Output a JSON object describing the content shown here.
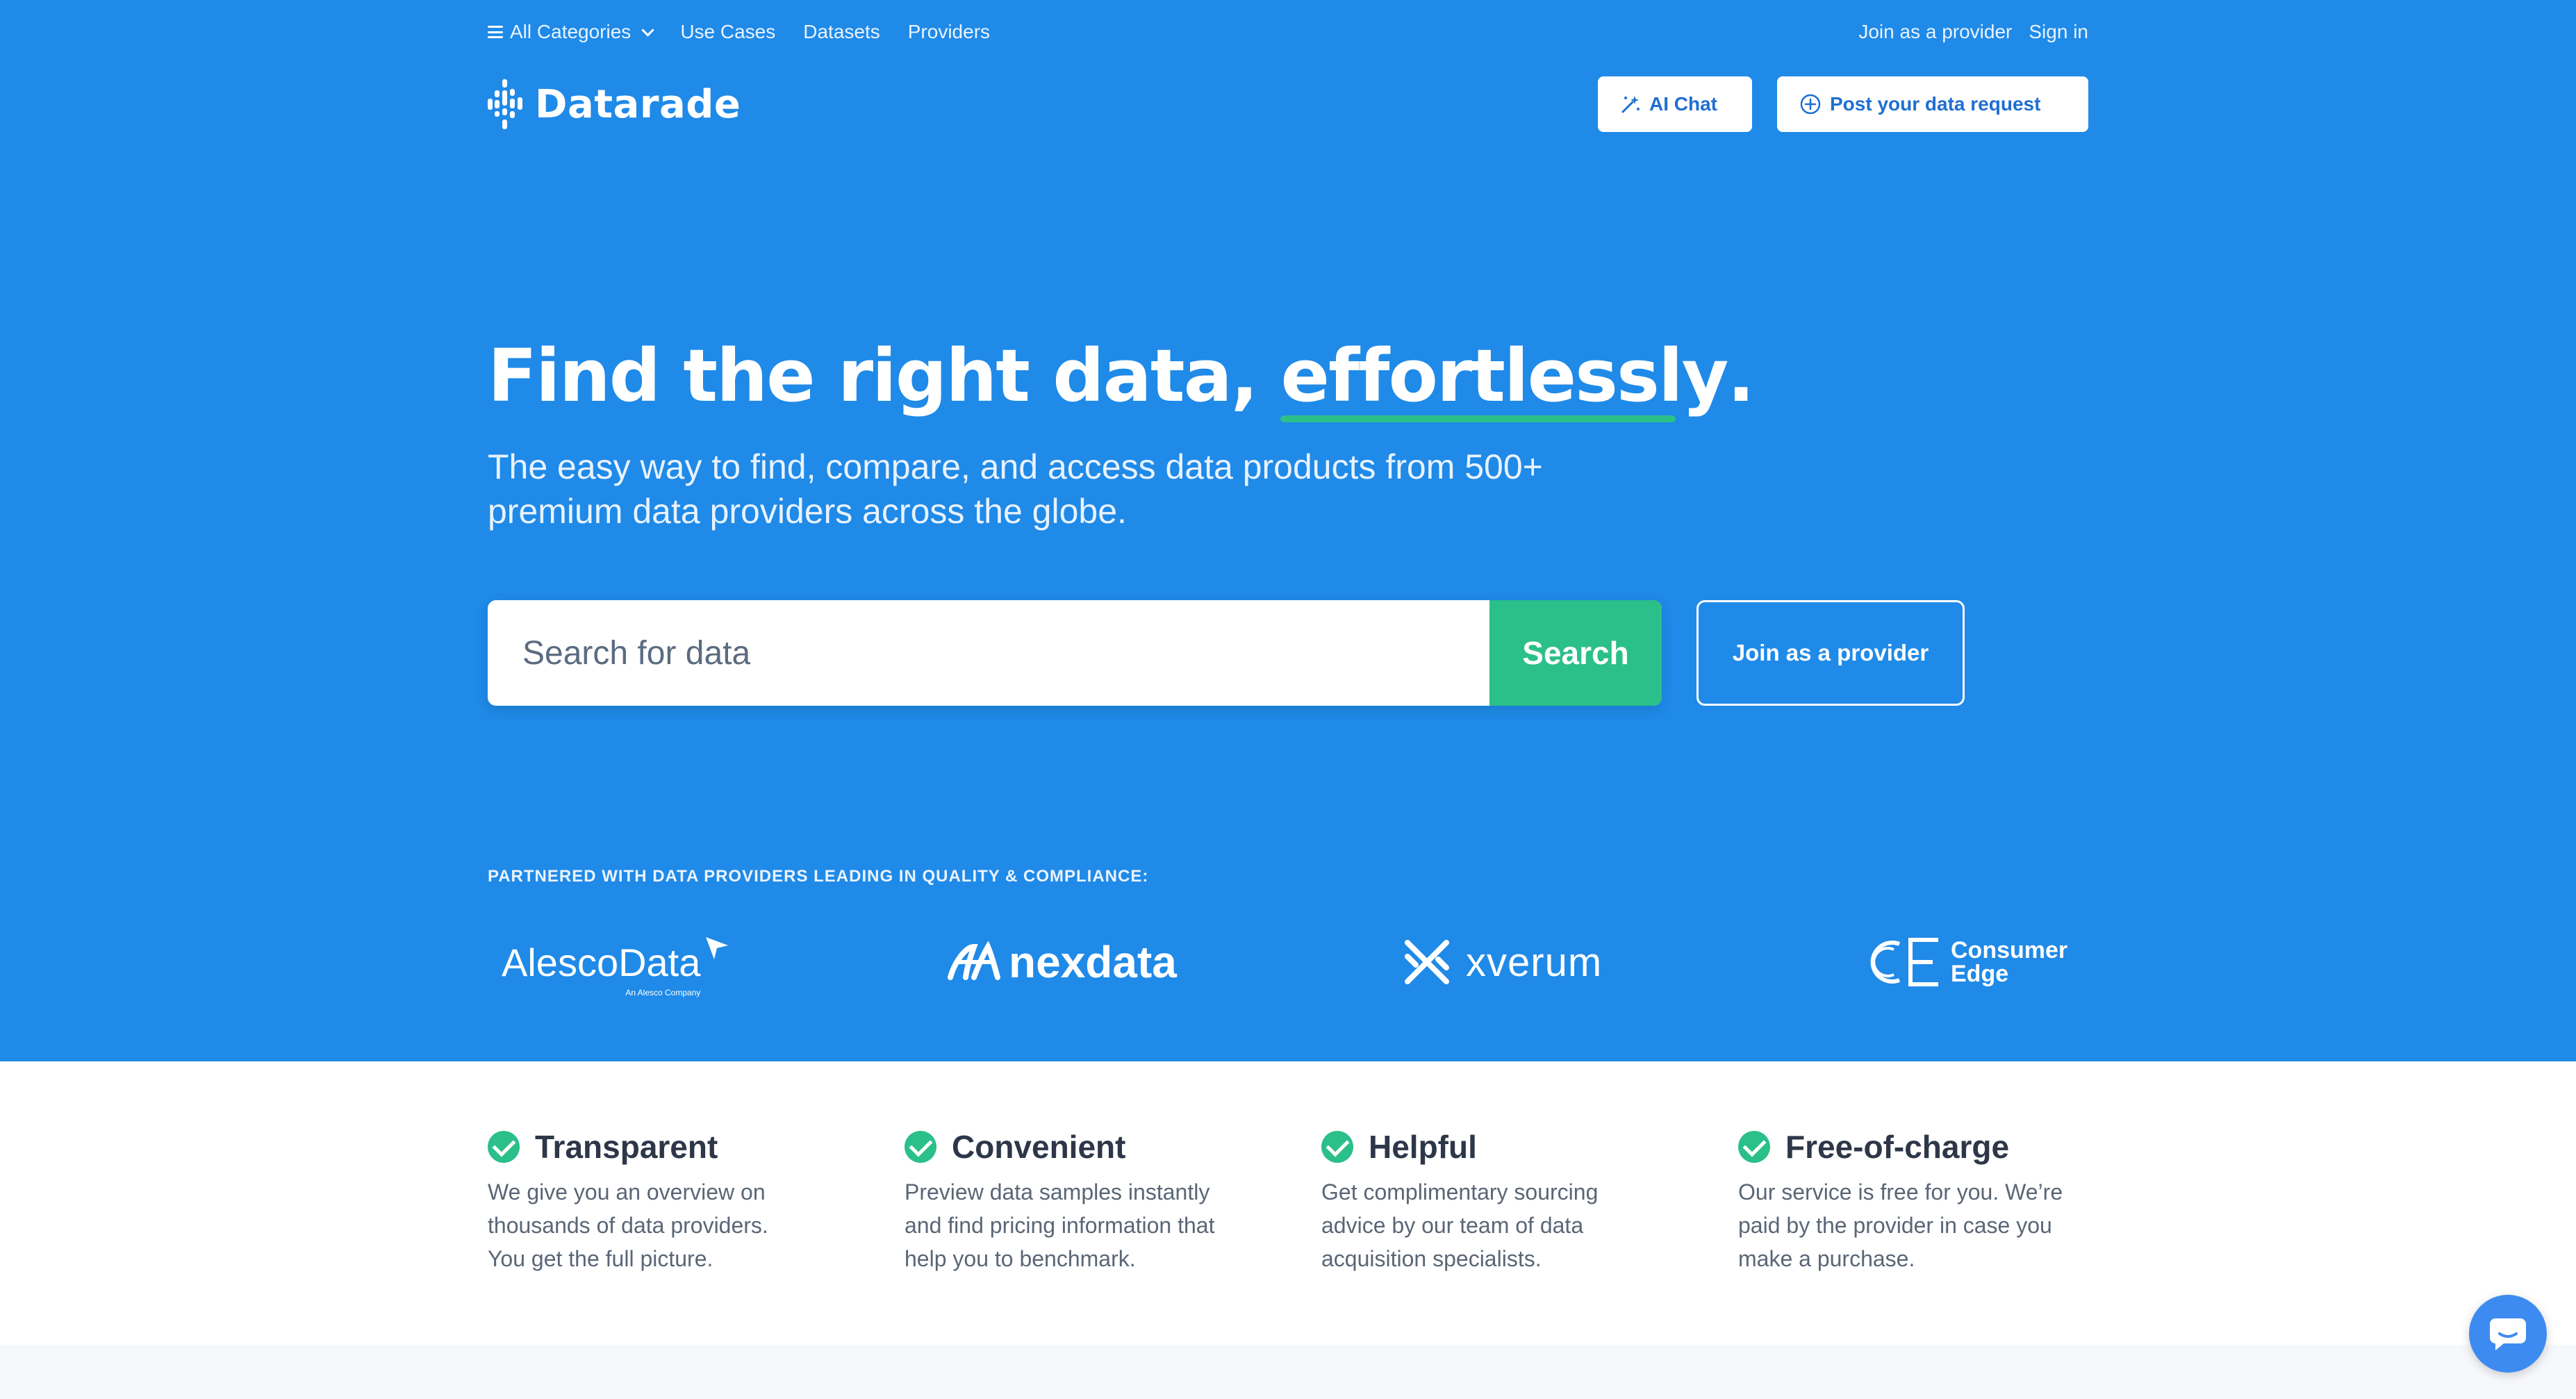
{
  "nav": {
    "categories": "All Categories",
    "links": [
      "Use Cases",
      "Datasets",
      "Providers"
    ],
    "join_provider": "Join as a provider",
    "sign_in": "Sign in"
  },
  "brand": {
    "name": "Datarade"
  },
  "header_buttons": {
    "ai_chat": "AI Chat",
    "post_request": "Post your data request"
  },
  "hero": {
    "headline_prefix": "Find the right data, ",
    "headline_emphasis": "effortlessly",
    "headline_suffix": ".",
    "subtitle_line1": "The easy way to find, compare, and access data products from 500+",
    "subtitle_line2": "premium data providers across the globe."
  },
  "search": {
    "placeholder": "Search for data",
    "button": "Search",
    "join_provider": "Join as a provider"
  },
  "partners": {
    "label": "PARTNERED WITH DATA PROVIDERS LEADING IN QUALITY & COMPLIANCE:",
    "logos": [
      {
        "name": "AlescoData",
        "tagline": "An Alesco Company"
      },
      {
        "name": "nexdata"
      },
      {
        "name": "xverum"
      },
      {
        "name_line1": "Consumer",
        "name_line2": "Edge"
      }
    ]
  },
  "features": [
    {
      "title": "Transparent",
      "desc": [
        "We give you an overview on",
        "thousands of data providers.",
        "You get the full picture."
      ]
    },
    {
      "title": "Convenient",
      "desc": [
        "Preview data samples instantly",
        "and find pricing information that",
        "help you to benchmark."
      ]
    },
    {
      "title": "Helpful",
      "desc": [
        "Get complimentary sourcing",
        "advice by our team of data",
        "acquisition specialists."
      ]
    },
    {
      "title": "Free-of-charge",
      "desc": [
        "Our service is free for you. We’re",
        "paid by the provider in case you",
        "make a purchase."
      ]
    }
  ],
  "colors": {
    "brand_blue": "#1f8ae8",
    "accent_green": "#2bbf8a",
    "chat_blue": "#3d8bf0"
  }
}
